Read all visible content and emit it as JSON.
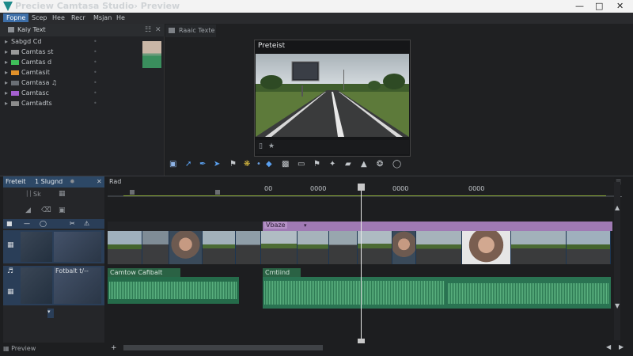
{
  "window": {
    "title": "Preciew Camtasa Studio› Preview",
    "minimize_icon": "minimize-icon",
    "maximize_icon": "maximize-icon",
    "close_icon": "close-icon"
  },
  "menu": [
    "Fopne",
    "Scep",
    "Hee",
    "Recr",
    "Msjan",
    "He"
  ],
  "media_bin": {
    "tab_label": "Kaiy Text",
    "root_item": "Sabgd Cd",
    "items": [
      {
        "label": "Camtas st",
        "color": "#9a9a9a"
      },
      {
        "label": "Camtas d",
        "color": "#3fbf5a"
      },
      {
        "label": "Camtasit",
        "color": "#e0902a"
      },
      {
        "label": "Camtasa ♫",
        "color": "#6a6f75"
      },
      {
        "label": "Camtasc",
        "color": "#a45fd0"
      },
      {
        "label": "Camtadts",
        "color": "#8c8c8c"
      }
    ]
  },
  "preview": {
    "tab_label": "Raaic Texte",
    "window_label": "Preteist"
  },
  "timeline": {
    "panel_tab": "Freteit",
    "panel_tab_2": "1 Slugnd",
    "panel_sub": "Sk",
    "ruler_label": "Rad",
    "ticks": [
      "00",
      "0000",
      "0000",
      "0000"
    ],
    "marker_clip": "Vbaze",
    "audio_clip_1": "Camtow Cafibalt",
    "audio_clip_2": "Cmtiind",
    "track_label_2": "Fotbalt t/--",
    "status": "Preview"
  },
  "colors": {
    "accent": "#3e6fa8",
    "video_track": "#2a4d74",
    "audio_track": "#2a7352",
    "marker": "#a07ab4",
    "playhead": "#e6e6e6"
  }
}
